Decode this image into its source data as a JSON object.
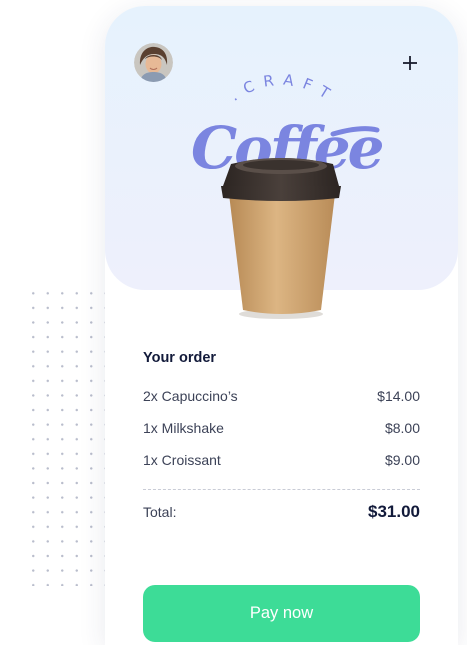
{
  "header": {
    "brand_top": "CRAFT",
    "brand_main": "Coffee",
    "add_icon": "plus-icon",
    "avatar_icon": "user-avatar"
  },
  "order": {
    "title": "Your order",
    "items": [
      {
        "name": "2x Capuccino’s",
        "price": "$14.00"
      },
      {
        "name": "1x Milkshake",
        "price": "$8.00"
      },
      {
        "name": "1x Croissant",
        "price": "$9.00"
      }
    ],
    "total_label": "Total:",
    "total_value": "$31.00"
  },
  "pay_button": {
    "label": "Pay now"
  },
  "colors": {
    "accent_green": "#3ddc97",
    "logo_purple": "#7b85e0",
    "heading_navy": "#121a3a",
    "hero_bg": "#e9f1fd"
  }
}
